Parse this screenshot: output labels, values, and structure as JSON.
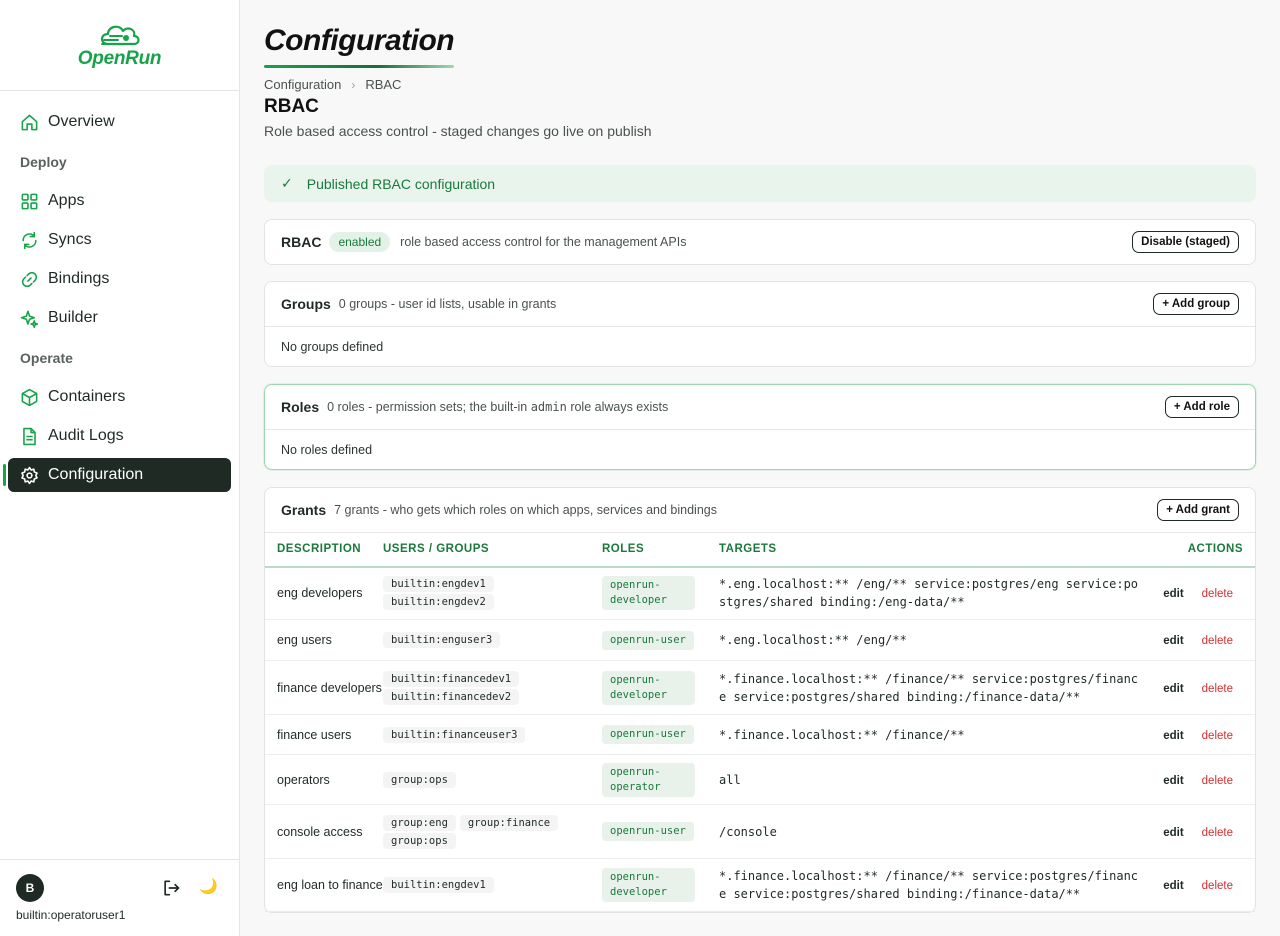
{
  "app": {
    "brand": "OpenRun"
  },
  "sidebar": {
    "items": [
      {
        "label": "Overview"
      },
      {
        "section": "Deploy"
      },
      {
        "label": "Apps"
      },
      {
        "label": "Syncs"
      },
      {
        "label": "Bindings"
      },
      {
        "label": "Builder"
      },
      {
        "section": "Operate"
      },
      {
        "label": "Containers"
      },
      {
        "label": "Audit Logs"
      },
      {
        "label": "Configuration",
        "active": true
      }
    ],
    "user": {
      "initial": "B",
      "name": "builtin:operatoruser1"
    }
  },
  "page": {
    "title": "Configuration",
    "breadcrumb": [
      "Configuration",
      "RBAC"
    ],
    "section_title": "RBAC",
    "section_subtitle": "Role based access control - staged changes go live on publish"
  },
  "banner": {
    "text": "Published RBAC configuration"
  },
  "rbac_card": {
    "title": "RBAC",
    "status": "enabled",
    "desc": "role based access control for the management APIs",
    "button": "Disable (staged)"
  },
  "groups_card": {
    "title": "Groups",
    "desc": "0 groups - user id lists, usable in grants",
    "button": "+ Add group",
    "empty": "No groups defined"
  },
  "roles_card": {
    "title": "Roles",
    "desc_prefix": "0 roles - permission sets; the built-in",
    "desc_code": "admin",
    "desc_suffix": "role always exists",
    "button": "+ Add role",
    "empty": "No roles defined"
  },
  "grants_card": {
    "title": "Grants",
    "desc": "7 grants - who gets which roles on which apps, services and bindings",
    "button": "+ Add grant",
    "columns": [
      "DESCRIPTION",
      "USERS / GROUPS",
      "ROLES",
      "TARGETS",
      "ACTIONS"
    ],
    "edit_label": "edit",
    "delete_label": "delete",
    "rows": [
      {
        "description": "eng developers",
        "users": [
          "builtin:engdev1",
          "builtin:engdev2"
        ],
        "role": "openrun-developer",
        "targets": "*.eng.localhost:** /eng/** service:postgres/eng service:postgres/shared binding:/eng-data/**"
      },
      {
        "description": "eng users",
        "users": [
          "builtin:enguser3"
        ],
        "role": "openrun-user",
        "targets": "*.eng.localhost:** /eng/**"
      },
      {
        "description": "finance developers",
        "users": [
          "builtin:financedev1",
          "builtin:financedev2"
        ],
        "role": "openrun-developer",
        "targets": "*.finance.localhost:** /finance/** service:postgres/finance service:postgres/shared binding:/finance-data/**"
      },
      {
        "description": "finance users",
        "users": [
          "builtin:financeuser3"
        ],
        "role": "openrun-user",
        "targets": "*.finance.localhost:** /finance/**"
      },
      {
        "description": "operators",
        "users": [
          "group:ops"
        ],
        "role": "openrun-operator",
        "targets": "all"
      },
      {
        "description": "console access",
        "users": [
          "group:eng",
          "group:finance",
          "group:ops"
        ],
        "role": "openrun-user",
        "targets": "/console"
      },
      {
        "description": "eng loan to finance",
        "users": [
          "builtin:engdev1"
        ],
        "role": "openrun-developer",
        "targets": "*.finance.localhost:** /finance/** service:postgres/finance service:postgres/shared binding:/finance-data/**"
      }
    ]
  },
  "colors": {
    "accent": "#17a34a",
    "active_bg": "#1e2a23",
    "danger": "#d32f2f"
  }
}
